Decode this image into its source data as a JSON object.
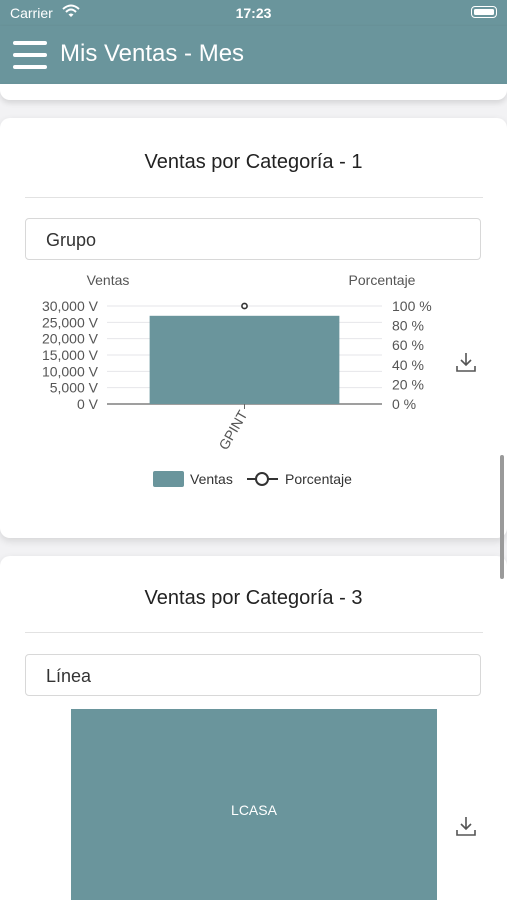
{
  "status_bar": {
    "carrier": "Carrier",
    "time": "17:23"
  },
  "app_bar": {
    "title": "Mis Ventas - Mes"
  },
  "cards": [
    {
      "title": "Ventas por Categoría - 1",
      "select_value": "Grupo"
    },
    {
      "title": "Ventas por Categoría - 3",
      "select_value": "Línea"
    }
  ],
  "chart_data": [
    {
      "type": "bar",
      "categories": [
        "GPINT"
      ],
      "series": [
        {
          "name": "Ventas",
          "type": "bar",
          "values": [
            27000
          ],
          "color": "#6a959c"
        },
        {
          "name": "Porcentaje",
          "type": "line",
          "values": [
            100
          ],
          "color": "#333333"
        }
      ],
      "ylabel_left": "Ventas",
      "ylabel_right": "Porcentaje",
      "y_ticks_left": [
        "30,000 V",
        "25,000 V",
        "20,000 V",
        "15,000 V",
        "10,000 V",
        "5,000 V",
        "0 V"
      ],
      "y_ticks_right": [
        "100 %",
        "80 %",
        "60 %",
        "40 %",
        "20 %",
        "0 %"
      ],
      "ylim_left": [
        0,
        30000
      ],
      "ylim_right": [
        0,
        100
      ],
      "legend": [
        "Ventas",
        "Porcentaje"
      ],
      "legend_position": "bottom"
    },
    {
      "type": "treemap",
      "categories": [
        "LCASA"
      ],
      "values": [
        100
      ],
      "color": "#6a959c"
    }
  ]
}
